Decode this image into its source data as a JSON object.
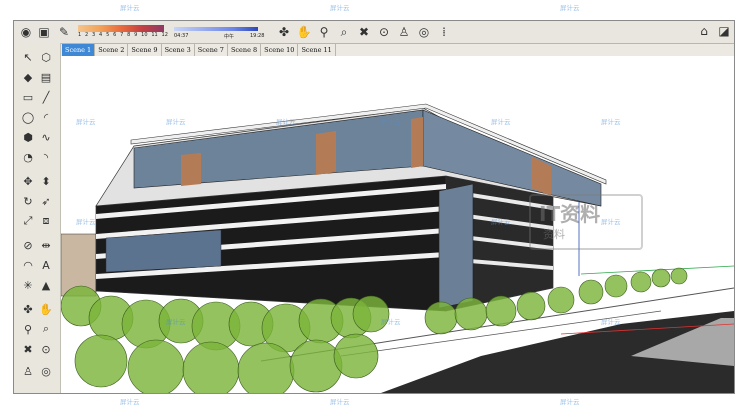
{
  "palette": {
    "numbers": [
      "1",
      "2",
      "3",
      "4",
      "5",
      "6",
      "7",
      "8",
      "9",
      "10",
      "11",
      "12"
    ]
  },
  "shadow_time": {
    "start": "04:37",
    "mid": "中午",
    "end": "19:28"
  },
  "tabs": [
    "Scene 1",
    "Scene 2",
    "Scene 9",
    "Scene 3",
    "Scene 7",
    "Scene 8",
    "Scene 10",
    "Scene 11"
  ],
  "active_tab": "Scene 1",
  "watermark": {
    "small": "屏计云",
    "big_logo": "IT资料",
    "big_sub": "资料"
  },
  "colors": {
    "tab_active": "#3f88d6",
    "tree_green": "#7bb53a",
    "glass": "#5f7690",
    "panel_bg": "#e9e6de"
  },
  "icons": {
    "top": [
      "eye-icon",
      "box-icon",
      "walk-icon",
      "orbit-icon",
      "pan-icon",
      "zoom-icon",
      "zoom-window-icon",
      "zoom-extents-icon",
      "position-camera-icon",
      "look-around-icon",
      "footprint-icon"
    ],
    "left": [
      "select-icon",
      "eraser-icon",
      "paint-bucket-icon",
      "rectangle-icon",
      "line-icon",
      "circle-icon",
      "arc-icon",
      "polygon-icon",
      "freehand-icon",
      "move-icon",
      "push-pull-icon",
      "rotate-icon",
      "follow-me-icon",
      "scale-icon",
      "offset-icon",
      "tape-measure-icon",
      "dimension-icon",
      "protractor-icon",
      "text-icon",
      "axes-icon",
      "3d-text-icon",
      "orbit-icon-left",
      "pan-icon-left",
      "zoom-icon-left",
      "zoom-window-icon-left",
      "zoom-extents-icon-left",
      "previous-icon",
      "walk-icon-left",
      "look-around-icon-left",
      "section-plane-icon"
    ]
  }
}
